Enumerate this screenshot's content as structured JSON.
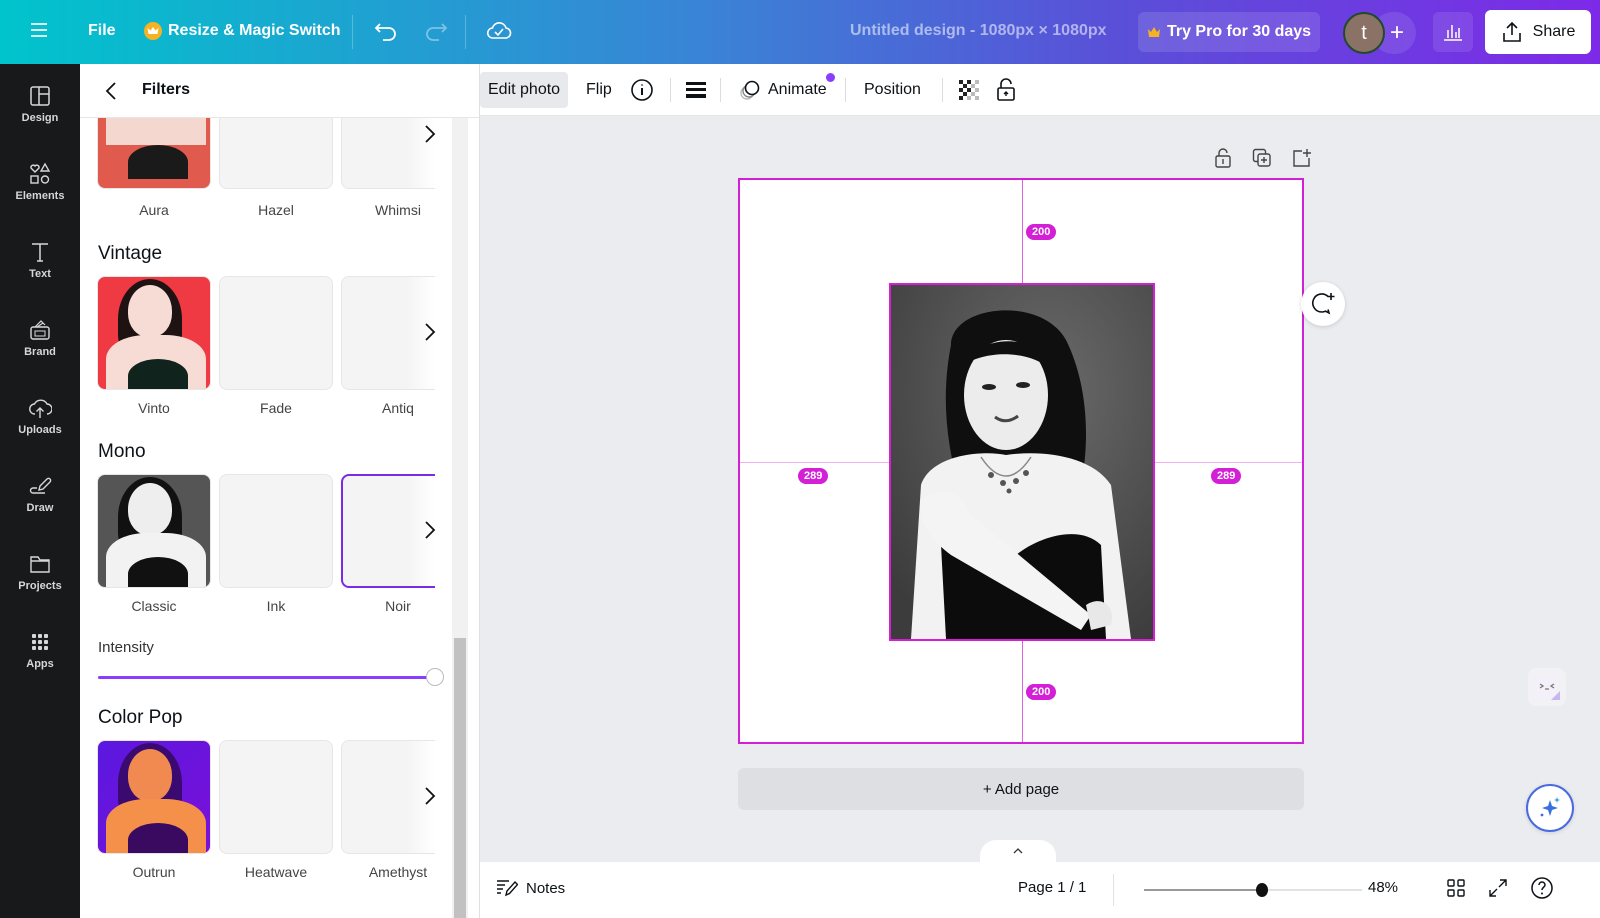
{
  "topbar": {
    "menu_icon": "hamburger-icon",
    "file_label": "File",
    "resize_label": "Resize & Magic Switch",
    "resize_icon": "crown-icon",
    "undo_icon": "undo-icon",
    "redo_icon": "redo-icon",
    "save_status_icon": "cloud-check-icon",
    "design_title": "Untitled design - 1080px × 1080px",
    "try_pro_label": "Try Pro for 30 days",
    "avatar_initial": "t",
    "add_collaborator_label": "+",
    "stats_icon": "bar-chart-icon",
    "share_label": "Share",
    "share_icon": "upload-icon"
  },
  "sidebar": {
    "items": [
      {
        "label": "Design",
        "icon": "layout-icon"
      },
      {
        "label": "Elements",
        "icon": "shapes-icon"
      },
      {
        "label": "Text",
        "icon": "text-icon"
      },
      {
        "label": "Brand",
        "icon": "brand-kit-icon"
      },
      {
        "label": "Uploads",
        "icon": "cloud-upload-icon"
      },
      {
        "label": "Draw",
        "icon": "draw-icon"
      },
      {
        "label": "Projects",
        "icon": "folder-icon"
      },
      {
        "label": "Apps",
        "icon": "apps-grid-icon"
      }
    ]
  },
  "panel": {
    "title": "Filters",
    "sections": [
      {
        "title": "",
        "filters": [
          "Aura",
          "Hazel",
          "Whimsi"
        ]
      },
      {
        "title": "Vintage",
        "filters": [
          "Vinto",
          "Fade",
          "Antiq"
        ]
      },
      {
        "title": "Mono",
        "filters": [
          "Classic",
          "Ink",
          "Noir"
        ],
        "selected": "Noir"
      },
      {
        "title": "Color Pop",
        "filters": [
          "Outrun",
          "Heatwave",
          "Amethyst"
        ]
      }
    ],
    "intensity_label": "Intensity",
    "intensity_value": 100
  },
  "toolbar": {
    "edit_photo": "Edit photo",
    "flip": "Flip",
    "info_icon": "info-icon",
    "lines_icon": "border-style-icon",
    "animate": "Animate",
    "position": "Position",
    "transparency_icon": "transparency-icon",
    "lock_icon": "lock-icon"
  },
  "canvas": {
    "spacing": {
      "top": "200",
      "bottom": "200",
      "left": "289",
      "right": "289"
    },
    "page_tools": [
      "lock-icon",
      "duplicate-page-icon",
      "add-page-icon"
    ],
    "add_page_label": "+ Add page",
    "accent_color": "#d31fd6"
  },
  "footer": {
    "notes_label": "Notes",
    "page_indicator": "Page 1 / 1",
    "zoom_percent": "48%",
    "zoom_value": 0.48,
    "grid_view_icon": "grid-view-icon",
    "fullscreen_icon": "expand-icon",
    "help_icon": "help-icon"
  }
}
